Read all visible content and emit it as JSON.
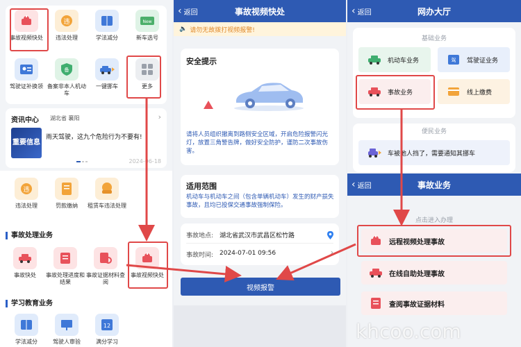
{
  "panel1": {
    "grid": [
      {
        "label": "事故视频快处",
        "icon": "video-accident-icon",
        "color": "#e8515a"
      },
      {
        "label": "违法处理",
        "icon": "violation-icon",
        "color": "#f2a43a"
      },
      {
        "label": "学法减分",
        "icon": "book-icon",
        "color": "#3f78d8"
      },
      {
        "label": "新车选号",
        "icon": "new-car-icon",
        "color": "#4caf6a"
      },
      {
        "label": "驾驶证补换领",
        "icon": "license-icon",
        "color": "#3f78d8"
      },
      {
        "label": "备案非本人机动车",
        "icon": "shield-icon",
        "color": "#3fae6f"
      },
      {
        "label": "一键挪车",
        "icon": "move-car-icon",
        "color": "#3f78d8"
      },
      {
        "label": "更多",
        "icon": "more-icon",
        "color": "#9aa0aa"
      }
    ],
    "news": {
      "title": "资讯中心",
      "location": "湖北省 襄阳",
      "badge": "重要信息",
      "headline": "雨天驾驶，这九个危险行为不要有!",
      "date": "2024-06-18"
    },
    "row1": [
      {
        "label": "违法处理",
        "icon": "violation-icon",
        "color": "#f2a43a"
      },
      {
        "label": "罚款缴纳",
        "icon": "fine-icon",
        "color": "#f2a43a"
      },
      {
        "label": "租赁车违法处理",
        "icon": "rental-car-icon",
        "color": "#f2a43a"
      }
    ],
    "section_accident": "事故处理业务",
    "accident_items": [
      {
        "label": "事故快处",
        "icon": "car-accident-icon",
        "color": "#e8515a"
      },
      {
        "label": "事故处理进度和结果",
        "icon": "progress-icon",
        "color": "#e8515a"
      },
      {
        "label": "事故证据材料查阅",
        "icon": "evidence-icon",
        "color": "#e8515a"
      },
      {
        "label": "事故视频快处",
        "icon": "video-accident-icon",
        "color": "#e8515a"
      }
    ],
    "section_study": "学习教育业务",
    "study_items": [
      {
        "label": "学法减分",
        "icon": "book-icon",
        "color": "#3f78d8"
      },
      {
        "label": "驾驶人审验",
        "icon": "review-icon",
        "color": "#3f78d8"
      },
      {
        "label": "满分学习",
        "icon": "score-icon",
        "color": "#3f78d8"
      }
    ]
  },
  "panel2": {
    "back": "返回",
    "title": "事故视频快处",
    "notice": "请勿无故拨打视频报警!",
    "safety_title": "安全提示",
    "safety_text": "请将人员组织撤离到路侧安全区域，开启危险报警闪光灯，放置三角警告牌，做好安全防护，谨防二次事故伤害。",
    "scope_title": "适用范围",
    "scope_text": "机动车与机动车之间（包含单辆机动车）发生的财产损失事故，且均已投保交通事故强制保险。",
    "location_label": "事故地点:",
    "location_value": "湖北省武汉市武昌区松竹路",
    "time_label": "事故时间:",
    "time_value": "2024-07-01 09:56",
    "submit": "视频报警"
  },
  "panel3": {
    "back": "返回",
    "title": "网办大厅",
    "basic_label": "基础业务",
    "basic_items": [
      {
        "label": "机动车业务",
        "icon": "car-icon",
        "color": "#3fae6f"
      },
      {
        "label": "驾驶证业务",
        "icon": "license-icon",
        "color": "#3f78d8"
      },
      {
        "label": "事故业务",
        "icon": "car-accident-icon",
        "color": "#e8515a"
      },
      {
        "label": "线上缴费",
        "icon": "payment-icon",
        "color": "#f2a43a"
      }
    ],
    "convenience_label": "便民业务",
    "move_car": "车被他人挡了，需要通知其挪车",
    "sub": {
      "back": "返回",
      "title": "事故业务",
      "enter_label": "点击进入办理",
      "items": [
        "远程视频处理事故",
        "在线自助处理事故",
        "查阅事故证据材料"
      ]
    }
  },
  "watermark": "khcoo.com"
}
